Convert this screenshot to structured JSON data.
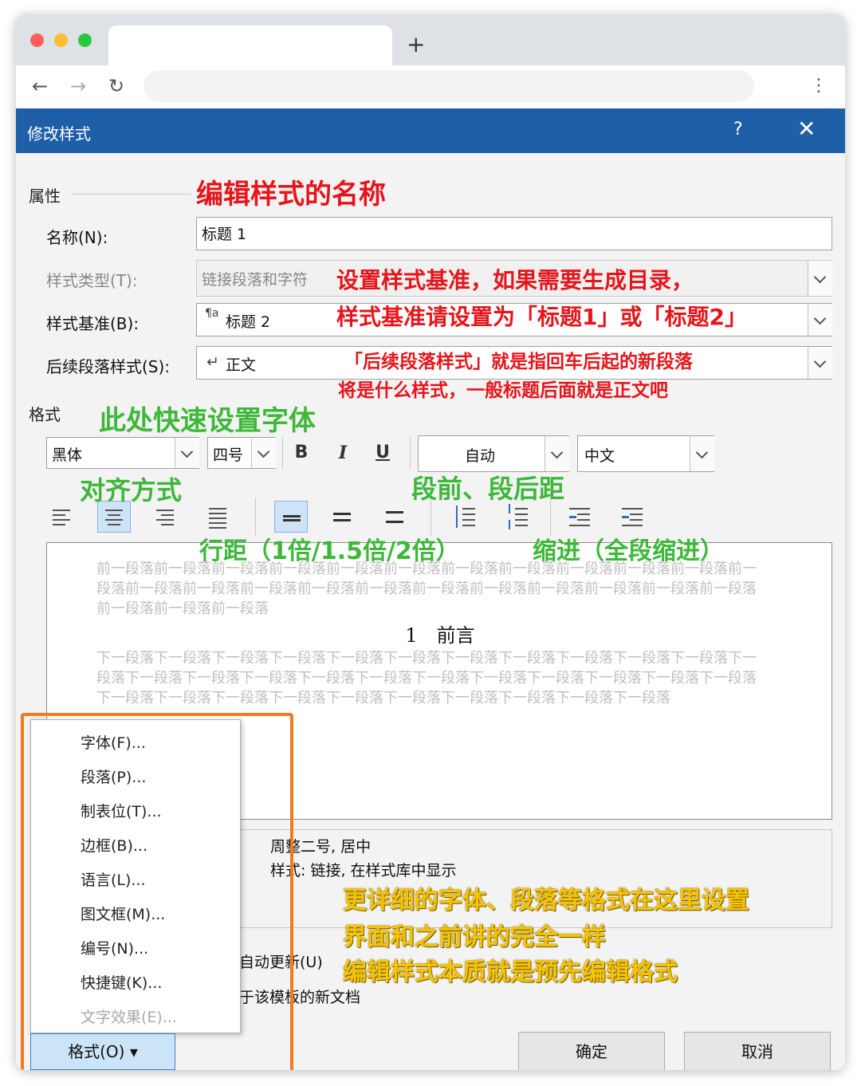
{
  "browser": {
    "new_tab_symbol": "+",
    "back_symbol": "←",
    "forward_symbol": "→",
    "reload_symbol": "↻",
    "menu_symbol": "⋮",
    "traffic_colors": [
      "#ff5f57",
      "#febc2e",
      "#28c840"
    ]
  },
  "dialog": {
    "title": "修改样式",
    "help_symbol": "?",
    "close_symbol": "✕",
    "properties_section": "属性",
    "name_label": "名称(N):",
    "name_value": "标题 1",
    "style_type_label": "样式类型(T):",
    "style_type_value": "链接段落和字符",
    "style_based_on_label": "样式基准(B):",
    "style_based_on_icon": "¶a",
    "style_based_on_value": "标题 2",
    "next_para_label": "后续段落样式(S):",
    "next_para_icon": "↵",
    "next_para_value": "正文",
    "format_section": "格式",
    "font_value": "黑体",
    "size_value": "四号",
    "bold": "B",
    "italic": "I",
    "underline": "U",
    "color_value": "自动",
    "language_value": "中文",
    "preview_before": "前一段落前一段落前一段落前一段落前一段落前一段落前一段落前一段落前一段落前一段落前一段落前一段落前一段落前一段落前一段落前一段落前一段落前一段落前一段落前一段落前一段落前一段落前一段落前一段落前一段落前一段落",
    "preview_heading": "1　前言",
    "preview_after": "下一段落下一段落下一段落下一段落下一段落下一段落下一段落下一段落下一段落下一段落下一段落下一段落下一段落下一段落下一段落下一段落下一段落下一段落下一段落下一段落下一段落下一段落下一段落下一段落下一段落下一段落下一段落下一段落下一段落下一段落下一段落下一段落下一段落",
    "desc_line1": "周整二号, 居中",
    "desc_line2": "样式: 链接, 在样式库中显示",
    "auto_update_partial": "自动更新(U)",
    "template_partial": "于该模板的新文档",
    "format_button": "格式(O) ▾",
    "ok_button": "确定",
    "cancel_button": "取消",
    "format_menu": [
      {
        "label": "字体(F)...",
        "disabled": false
      },
      {
        "label": "段落(P)...",
        "disabled": false
      },
      {
        "label": "制表位(T)...",
        "disabled": false
      },
      {
        "label": "边框(B)...",
        "disabled": false
      },
      {
        "label": "语言(L)...",
        "disabled": false
      },
      {
        "label": "图文框(M)...",
        "disabled": false
      },
      {
        "label": "编号(N)...",
        "disabled": false
      },
      {
        "label": "快捷键(K)...",
        "disabled": false
      },
      {
        "label": "文字效果(E)...",
        "disabled": true
      }
    ]
  },
  "annotations": {
    "name_hint": "编辑样式的名称",
    "base_hint_1": "设置样式基准，如果需要生成目录，",
    "base_hint_2": "样式基准请设置为「标题1」或「标题2」",
    "next_hint_1": "「后续段落样式」就是指回车后起的新段落",
    "next_hint_2": "将是什么样式，一般标题后面就是正文吧",
    "font_hint": "此处快速设置字体",
    "align_hint": "对齐方式",
    "spacing_hint": "段前、段后距",
    "line_spacing_hint": "行距（1倍/1.5倍/2倍）",
    "indent_hint": "缩进（全段缩进）",
    "detail_hint_1": "更详细的字体、段落等格式在这里设置",
    "detail_hint_2": "界面和之前讲的完全一样",
    "detail_hint_3": "编辑样式本质就是预先编辑格式",
    "colors": {
      "red": "#e5151b",
      "green": "#3db83a",
      "yellow": "#f5c400",
      "orange": "#f47920",
      "title_blue": "#1f5fa8"
    }
  }
}
